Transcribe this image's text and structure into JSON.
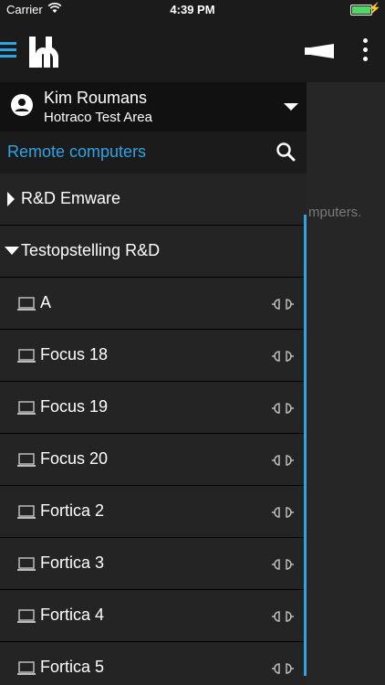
{
  "status": {
    "carrier": "Carrier",
    "time": "4:39 PM"
  },
  "toolbar": {
    "logo": "hotraco-logo"
  },
  "user": {
    "name": "Kim Roumans",
    "area": "Hotraco Test Area"
  },
  "search": {
    "title": "Remote computers"
  },
  "background": {
    "text": "mputers."
  },
  "groups": [
    {
      "label": "R&D Emware",
      "expanded": false
    },
    {
      "label": "Testopstelling R&D",
      "expanded": true
    }
  ],
  "computers": [
    {
      "label": "A"
    },
    {
      "label": "Focus 18"
    },
    {
      "label": "Focus 19"
    },
    {
      "label": "Focus 20"
    },
    {
      "label": "Fortica 2"
    },
    {
      "label": "Fortica 3"
    },
    {
      "label": "Fortica 4"
    },
    {
      "label": "Fortica 5"
    }
  ],
  "colors": {
    "accent": "#2fa3e6",
    "background": "#1b1b1b",
    "row": "#242424"
  }
}
